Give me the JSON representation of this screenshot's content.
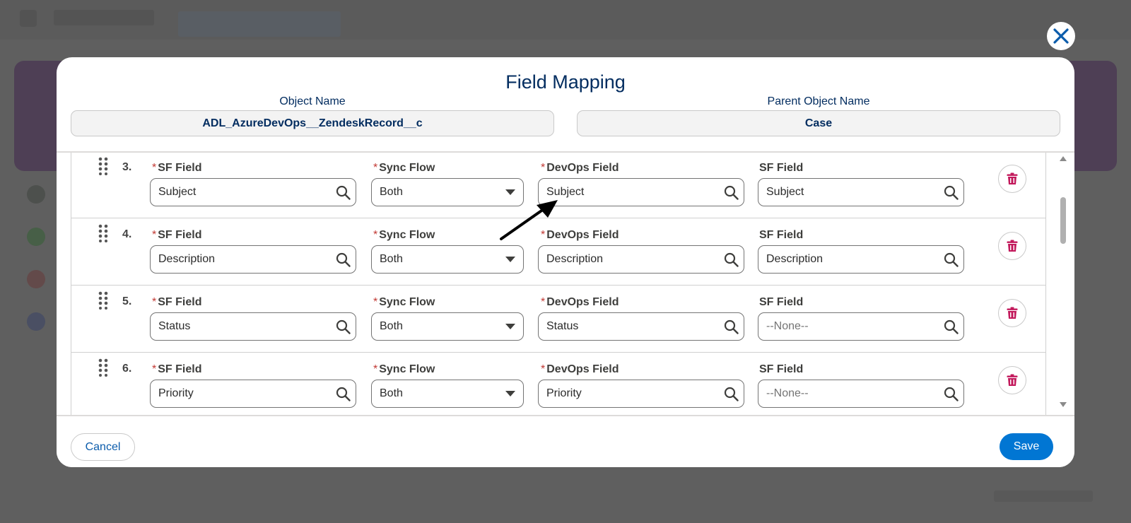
{
  "modal": {
    "title": "Field Mapping",
    "object_name_label": "Object Name",
    "object_name_value": "ADL_AzureDevOps__ZendeskRecord__c",
    "parent_object_name_label": "Parent Object Name",
    "parent_object_name_value": "Case"
  },
  "rows": [
    {
      "number": "3.",
      "sf_field_label": "SF Field",
      "sf_field_value": "Subject",
      "sync_flow_label": "Sync Flow",
      "sync_flow_value": "Both",
      "devops_field_label": "DevOps Field",
      "devops_field_value": "Subject",
      "sf_field2_label": "SF Field",
      "sf_field2_value": "Subject"
    },
    {
      "number": "4.",
      "sf_field_label": "SF Field",
      "sf_field_value": "Description",
      "sync_flow_label": "Sync Flow",
      "sync_flow_value": "Both",
      "devops_field_label": "DevOps Field",
      "devops_field_value": "Description",
      "sf_field2_label": "SF Field",
      "sf_field2_value": "Description"
    },
    {
      "number": "5.",
      "sf_field_label": "SF Field",
      "sf_field_value": "Status",
      "sync_flow_label": "Sync Flow",
      "sync_flow_value": "Both",
      "devops_field_label": "DevOps Field",
      "devops_field_value": "Status",
      "sf_field2_label": "SF Field",
      "sf_field2_value": "--None--"
    },
    {
      "number": "6.",
      "sf_field_label": "SF Field",
      "sf_field_value": "Priority",
      "sync_flow_label": "Sync Flow",
      "sync_flow_value": "Both",
      "devops_field_label": "DevOps Field",
      "devops_field_value": "Priority",
      "sf_field2_label": "SF Field",
      "sf_field2_value": "--None--"
    }
  ],
  "required_marker": "*",
  "footer": {
    "cancel_label": "Cancel",
    "save_label": "Save"
  },
  "icons": {
    "close": "close-icon",
    "search": "search-icon",
    "caret": "chevron-down-icon",
    "delete": "trash-icon",
    "drag": "drag-handle-icon",
    "annotation": "arrow-icon"
  },
  "colors": {
    "brand_blue": "#0176d3",
    "title_navy": "#032d60",
    "required_red": "#c23934",
    "delete_pink": "#c2185b"
  }
}
